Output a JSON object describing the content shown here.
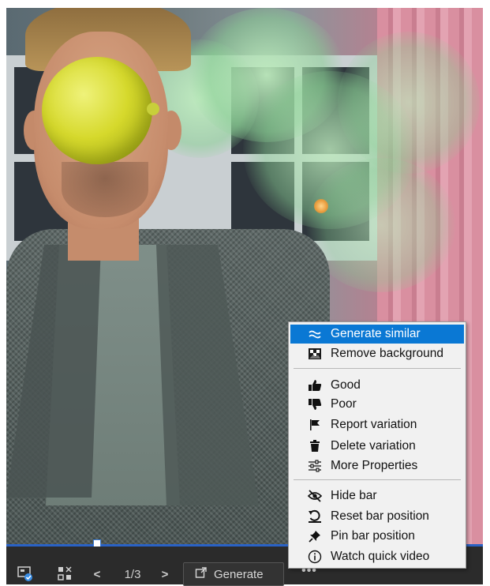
{
  "menu": {
    "items": [
      {
        "label": "Generate similar",
        "icon": "approx-icon",
        "highlighted": true
      },
      {
        "label": "Remove background",
        "icon": "remove-background-icon"
      },
      {
        "label": "Good",
        "icon": "thumbs-up-icon"
      },
      {
        "label": "Poor",
        "icon": "thumbs-down-icon"
      },
      {
        "label": "Report variation",
        "icon": "flag-icon"
      },
      {
        "label": "Delete variation",
        "icon": "trash-icon"
      },
      {
        "label": "More Properties",
        "icon": "sliders-icon"
      },
      {
        "label": "Hide bar",
        "icon": "eye-off-icon"
      },
      {
        "label": "Reset bar position",
        "icon": "reset-icon"
      },
      {
        "label": "Pin bar position",
        "icon": "pin-icon"
      },
      {
        "label": "Watch quick video",
        "icon": "info-icon"
      }
    ]
  },
  "toolbar": {
    "page_indicator": "1/3",
    "generate_label": "Generate",
    "more_label": "•••",
    "prev_label": "<",
    "next_label": ">"
  },
  "colors": {
    "menu_highlight": "#0a78d4",
    "toolbar_bg": "#2b2b2b",
    "selection_line": "#2a62c5"
  }
}
